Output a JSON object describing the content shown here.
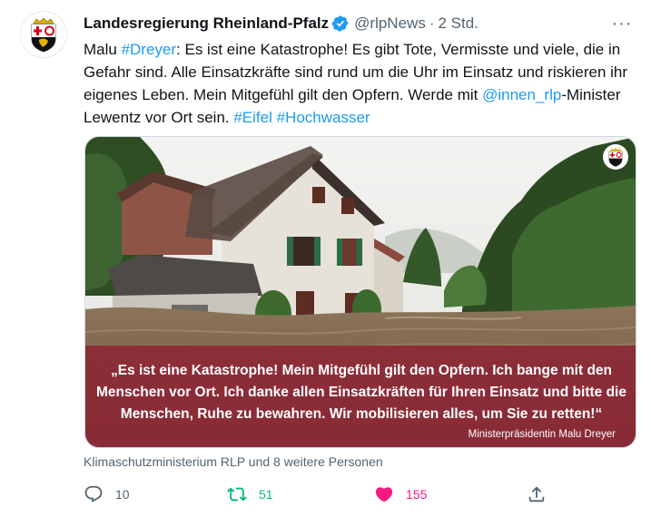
{
  "tweet": {
    "author_name": "Landesregierung Rheinland-Pfalz",
    "handle": "@rlpNews",
    "separator": "·",
    "time": "2 Std.",
    "more_label": "···",
    "text": {
      "t1": "Malu ",
      "t2": "#Dreyer",
      "t3": ": Es ist eine Katastrophe! Es gibt Tote, Vermisste und viele, die in Gefahr sind. Alle Einsatzkräfte sind rund um die Uhr im Einsatz und riskieren ihr eigenes Leben. Mein Mitgefühl gilt den Opfern. Werde mit ",
      "t4": "@innen_rlp",
      "t5": "-Minister Lewentz vor Ort sein. ",
      "t6": "#Eifel",
      "t7": " ",
      "t8": "#Hochwasser"
    },
    "media": {
      "quote": "„Es ist eine Katastrophe! Mein Mitgefühl gilt den Opfern. Ich bange mit den Menschen vor Ort. Ich danke allen Einsatzkräften für Ihren Einsatz und bitte die Menschen, Ruhe zu bewahren. Wir mobilisieren alles, um Sie zu retten!“",
      "attribution": "Ministerpräsidentin Malu Dreyer"
    },
    "social_context": "Klimaschutzministerium RLP und 8 weitere Personen",
    "actions": {
      "reply_count": "10",
      "retweet_count": "51",
      "like_count": "155"
    }
  },
  "colors": {
    "link": "#1d9bf0",
    "retweeted": "#00ba7c",
    "liked": "#f91880",
    "quote_overlay": "#8e2234"
  },
  "icons": {
    "avatar": "rlp-coat-of-arms",
    "verified": "verified-badge-icon",
    "reply": "reply-icon",
    "retweet": "retweet-icon",
    "like": "heart-icon",
    "share": "share-icon"
  }
}
